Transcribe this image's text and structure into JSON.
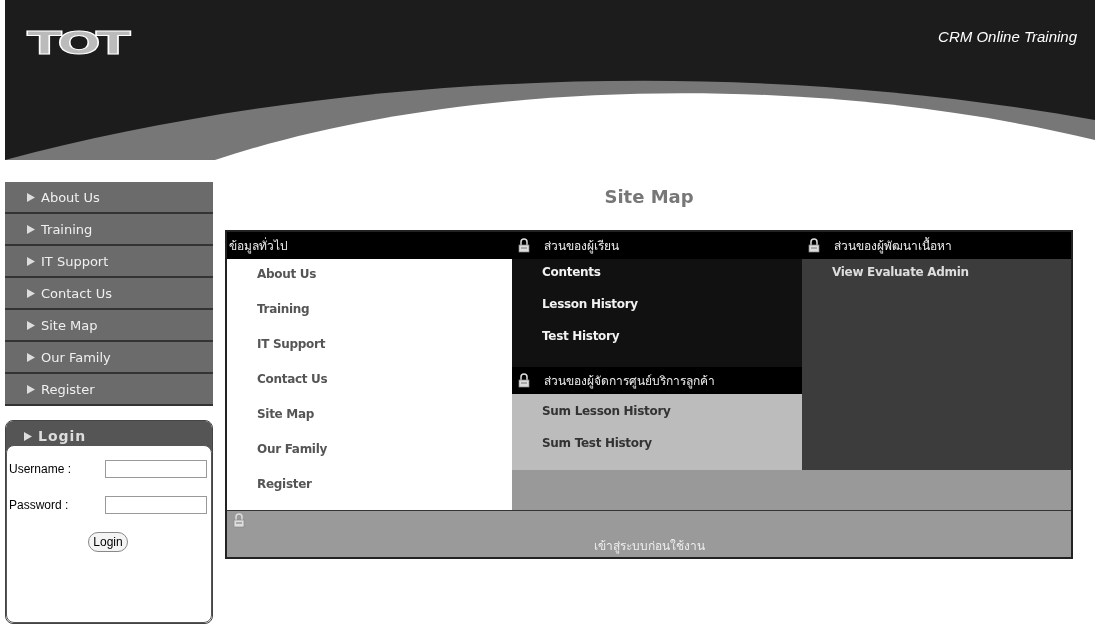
{
  "header": {
    "logo": "TOT",
    "title": "CRM Online Training"
  },
  "nav": {
    "items": [
      {
        "label": "About Us"
      },
      {
        "label": "Training"
      },
      {
        "label": "IT Support"
      },
      {
        "label": "Contact Us"
      },
      {
        "label": "Site Map"
      },
      {
        "label": "Our Family"
      },
      {
        "label": "Register"
      }
    ]
  },
  "login": {
    "title": "Login",
    "fields": [
      {
        "label": "Username :"
      },
      {
        "label": "Password :"
      }
    ],
    "button": "Login"
  },
  "sitemap": {
    "title": "Site Map",
    "sections": [
      {
        "heading": "ข้อมูลทั่วไป",
        "locked": false,
        "links": [
          "About Us",
          "Training",
          "IT Support",
          "Contact Us",
          "Site Map",
          "Our Family",
          "Register"
        ]
      },
      {
        "heading": "ส่วนของผู้เรียน",
        "locked": true,
        "links": [
          "Contents",
          "Lesson History",
          "Test History"
        ]
      },
      {
        "heading": "ส่วนของผู้จัดการศูนย์บริการลูกค้า",
        "locked": true,
        "links": [
          "Sum Lesson History",
          "Sum Test History"
        ]
      },
      {
        "heading": "ส่วนของผู้พัฒนาเนื้อหา",
        "locked": true,
        "links": [
          "View Evaluate Admin"
        ]
      }
    ],
    "footer": {
      "text": "เข้าสู่ระบบก่อนใช้งาน",
      "locked": true
    }
  }
}
